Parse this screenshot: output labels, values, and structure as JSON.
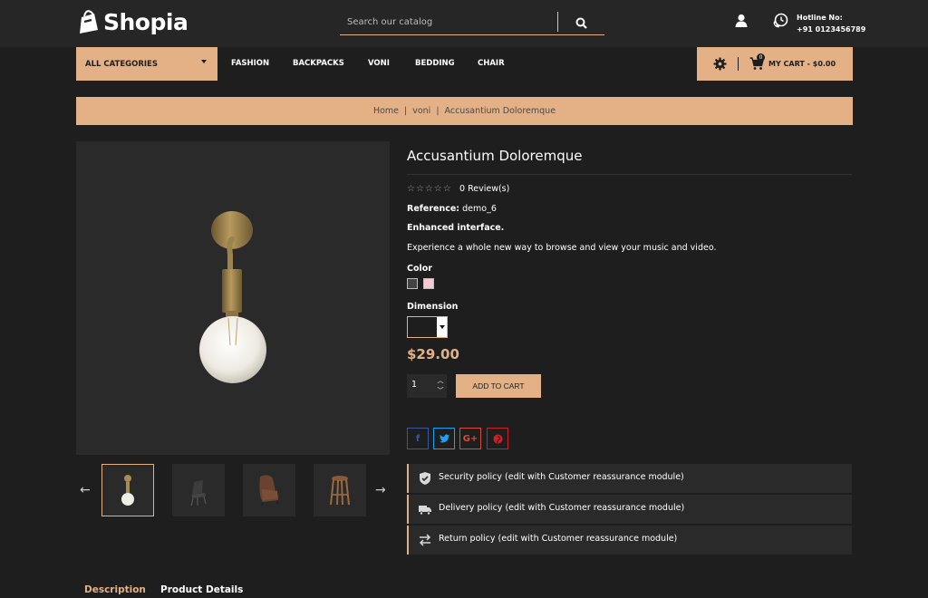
{
  "header": {
    "logo_text": "Shopia",
    "search_placeholder": "Search our catalog",
    "hotline_label": "Hotline No:",
    "hotline_number": "+91 0123456789"
  },
  "nav": {
    "all_categories": "ALL CATEGORIES",
    "items": [
      "FASHION",
      "BACKPACKS",
      "VONI",
      "BEDDING",
      "CHAIR"
    ],
    "cart_count": "0",
    "cart_label": "MY CART - $0.00"
  },
  "breadcrumb": {
    "home": "Home",
    "category": "voni",
    "current": "Accusantium Doloremque",
    "separator": "|"
  },
  "product": {
    "title": "Accusantium Doloremque",
    "stars": "☆☆☆☆☆",
    "reviews": "0 Review(s)",
    "reference_label": "Reference:",
    "reference_value": "demo_6",
    "enhanced": "Enhanced interface.",
    "description": "Experience a whole new way to browse and view your music and video.",
    "color_label": "Color",
    "colors": [
      "#434343",
      "#f7c8d2"
    ],
    "dimension_label": "Dimension",
    "price": "$29.00",
    "quantity": "1",
    "add_to_cart": "ADD TO CART"
  },
  "social": {
    "facebook": "f",
    "twitter": "t",
    "google": "G+",
    "pinterest": "p",
    "colors": {
      "facebook": "#3b5998",
      "twitter": "#1da1f2",
      "google": "#dd4b39",
      "pinterest": "#cb2027"
    }
  },
  "policies": [
    {
      "icon": "shield-icon",
      "text": "Security policy (edit with Customer reassurance module)"
    },
    {
      "icon": "truck-icon",
      "text": "Delivery policy (edit with Customer reassurance module)"
    },
    {
      "icon": "swap-arrows-icon",
      "text": "Return policy (edit with Customer reassurance module)"
    }
  ],
  "tabs": {
    "description": "Description",
    "product_details": "Product Details"
  },
  "theme": {
    "accent": "#e3b185",
    "background": "#1e1e1e",
    "panel": "#2a2a2a"
  }
}
